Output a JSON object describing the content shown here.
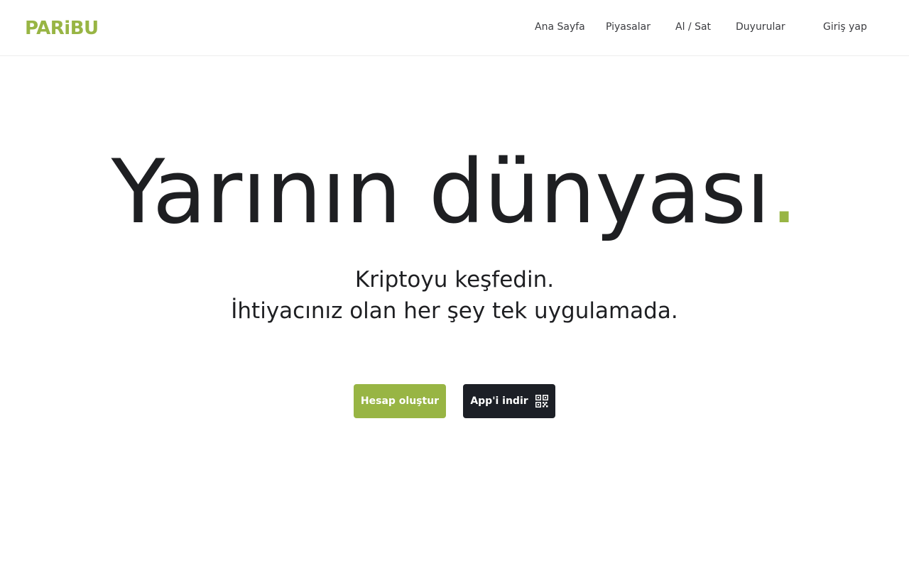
{
  "brand": {
    "name": "PARiBU",
    "accent_color": "#98b544",
    "dark_color": "#1c1f26",
    "text_color": "#1e1f22"
  },
  "nav": {
    "items": [
      {
        "label": "Ana Sayfa"
      },
      {
        "label": "Piyasalar"
      },
      {
        "label": "Al / Sat"
      },
      {
        "label": "Duyurular"
      }
    ],
    "login_label": "Giriş yap"
  },
  "hero": {
    "title": "Yarının dünyası",
    "title_dot": ".",
    "subtitle_line1": "Kriptoyu keşfedin.",
    "subtitle_line2": "İhtiyacınız olan her şey tek uygulamada."
  },
  "actions": {
    "create_account_label": "Hesap oluştur",
    "download_app_label": "App'i indir",
    "download_app_icon": "qr-code-icon"
  }
}
